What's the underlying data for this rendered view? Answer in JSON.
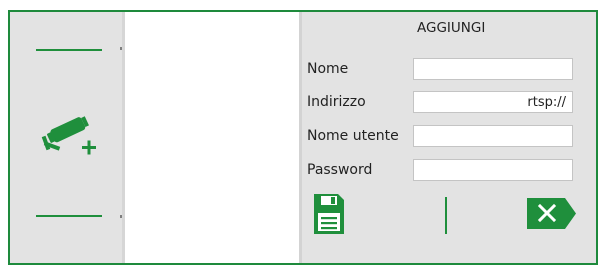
{
  "form": {
    "heading": "AGGIUNGI",
    "name_label": "Nome",
    "name_value": "",
    "address_label": "Indirizzo",
    "address_value": "rtsp://",
    "username_label": "Nome utente",
    "username_value": "",
    "password_label": "Password",
    "password_value": ""
  },
  "icons": {
    "add_camera": "camera-add-icon",
    "save": "floppy-disk-icon",
    "cancel": "close-icon"
  },
  "colors": {
    "accent": "#1e8a3c",
    "panel_bg": "#e3e3e3",
    "field_bg": "#ffffff"
  }
}
